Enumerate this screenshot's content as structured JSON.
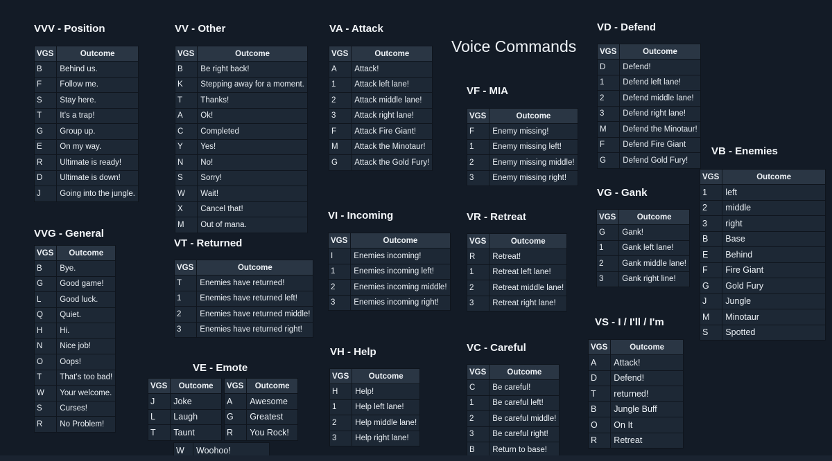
{
  "title": "Voice Commands",
  "col_key": "VGS",
  "col_outcome": "Outcome",
  "sections": {
    "vvv": {
      "heading": "VVV - Position",
      "rows": [
        [
          "B",
          "Behind us."
        ],
        [
          "F",
          "Follow me."
        ],
        [
          "S",
          "Stay here."
        ],
        [
          "T",
          "It’s a trap!"
        ],
        [
          "G",
          "Group up."
        ],
        [
          "E",
          "On my way."
        ],
        [
          "R",
          "Ultimate is ready!"
        ],
        [
          "D",
          "Ultimate is down!"
        ],
        [
          "J",
          "Going into the jungle."
        ]
      ]
    },
    "vv": {
      "heading": "VV - Other",
      "rows": [
        [
          "B",
          "Be right back!"
        ],
        [
          "K",
          "Stepping away for a moment."
        ],
        [
          "T",
          "Thanks!"
        ],
        [
          "A",
          "Ok!"
        ],
        [
          "C",
          "Completed"
        ],
        [
          "Y",
          "Yes!"
        ],
        [
          "N",
          "No!"
        ],
        [
          "S",
          "Sorry!"
        ],
        [
          "W",
          "Wait!"
        ],
        [
          "X",
          "Cancel that!"
        ],
        [
          "M",
          "Out of mana."
        ]
      ]
    },
    "va": {
      "heading": "VA - Attack",
      "rows": [
        [
          "A",
          "Attack!"
        ],
        [
          "1",
          "Attack left lane!"
        ],
        [
          "2",
          "Attack middle lane!"
        ],
        [
          "3",
          "Attack right lane!"
        ],
        [
          "F",
          "Attack Fire Giant!"
        ],
        [
          "M",
          "Attack the Minotaur!"
        ],
        [
          "G",
          "Attack the Gold Fury!"
        ]
      ]
    },
    "vd": {
      "heading": "VD - Defend",
      "rows": [
        [
          "D",
          "Defend!"
        ],
        [
          "1",
          "Defend left lane!"
        ],
        [
          "2",
          "Defend middle lane!"
        ],
        [
          "3",
          "Defend right lane!"
        ],
        [
          "M",
          "Defend the Minotaur!"
        ],
        [
          "F",
          "Defend Fire Giant"
        ],
        [
          "G",
          "Defend Gold Fury!"
        ]
      ]
    },
    "vf": {
      "heading": "VF - MIA",
      "rows": [
        [
          "F",
          "Enemy missing!"
        ],
        [
          "1",
          "Enemy missing left!"
        ],
        [
          "2",
          "Enemy missing middle!"
        ],
        [
          "3",
          "Enemy missing right!"
        ]
      ]
    },
    "vb": {
      "heading": "VB - Enemies",
      "rows": [
        [
          "1",
          "left"
        ],
        [
          "2",
          "middle"
        ],
        [
          "3",
          "right"
        ],
        [
          "B",
          "Base"
        ],
        [
          "E",
          "Behind"
        ],
        [
          "F",
          "Fire Giant"
        ],
        [
          "G",
          "Gold Fury"
        ],
        [
          "J",
          "Jungle"
        ],
        [
          "M",
          "Minotaur"
        ],
        [
          "S",
          "Spotted"
        ]
      ]
    },
    "vg": {
      "heading": "VG - Gank",
      "rows": [
        [
          "G",
          "Gank!"
        ],
        [
          "1",
          "Gank left lane!"
        ],
        [
          "2",
          "Gank middle lane!"
        ],
        [
          "3",
          "Gank right line!"
        ]
      ]
    },
    "vvg": {
      "heading": "VVG - General",
      "rows": [
        [
          "B",
          "Bye."
        ],
        [
          "G",
          "Good game!"
        ],
        [
          "L",
          "Good luck."
        ],
        [
          "Q",
          "Quiet."
        ],
        [
          "H",
          "Hi."
        ],
        [
          "N",
          "Nice job!"
        ],
        [
          "O",
          "Oops!"
        ],
        [
          "T",
          "That’s too bad!"
        ],
        [
          "W",
          "Your welcome."
        ],
        [
          "S",
          "Curses!"
        ],
        [
          "R",
          "No Problem!"
        ]
      ]
    },
    "vt": {
      "heading": "VT - Returned",
      "rows": [
        [
          "T",
          "Enemies have returned!"
        ],
        [
          "1",
          "Enemies have returned left!"
        ],
        [
          "2",
          "Enemies have returned middle!"
        ],
        [
          "3",
          "Enemies have returned right!"
        ]
      ]
    },
    "vi": {
      "heading": "VI - Incoming",
      "rows": [
        [
          "I",
          "Enemies incoming!"
        ],
        [
          "1",
          "Enemies incoming left!"
        ],
        [
          "2",
          "Enemies incoming middle!"
        ],
        [
          "3",
          "Enemies incoming right!"
        ]
      ]
    },
    "vr": {
      "heading": "VR - Retreat",
      "rows": [
        [
          "R",
          "Retreat!"
        ],
        [
          "1",
          "Retreat left lane!"
        ],
        [
          "2",
          "Retreat middle lane!"
        ],
        [
          "3",
          "Retreat right lane!"
        ]
      ]
    },
    "vs": {
      "heading": "VS - I / I'll / I'm",
      "rows": [
        [
          "A",
          "Attack!"
        ],
        [
          "D",
          "Defend!"
        ],
        [
          "T",
          "returned!"
        ],
        [
          "B",
          "Jungle Buff"
        ],
        [
          "O",
          "On It"
        ],
        [
          "R",
          "Retreat"
        ]
      ]
    },
    "ve": {
      "heading": "VE - Emote",
      "rows_a": [
        [
          "J",
          "Joke"
        ],
        [
          "L",
          "Laugh"
        ],
        [
          "T",
          "Taunt"
        ]
      ],
      "rows_b": [
        [
          "A",
          "Awesome"
        ],
        [
          "G",
          "Greatest"
        ],
        [
          "R",
          "You Rock!"
        ]
      ],
      "extra": [
        "W",
        "Woohoo!"
      ]
    },
    "vh": {
      "heading": "VH - Help",
      "rows": [
        [
          "H",
          "Help!"
        ],
        [
          "1",
          "Help left lane!"
        ],
        [
          "2",
          "Help middle lane!"
        ],
        [
          "3",
          "Help right lane!"
        ]
      ]
    },
    "vc": {
      "heading": "VC - Careful",
      "rows": [
        [
          "C",
          "Be careful!"
        ],
        [
          "1",
          "Be careful left!"
        ],
        [
          "2",
          "Be careful middle!"
        ],
        [
          "3",
          "Be careful right!"
        ],
        [
          "B",
          "Return to base!"
        ]
      ]
    }
  }
}
